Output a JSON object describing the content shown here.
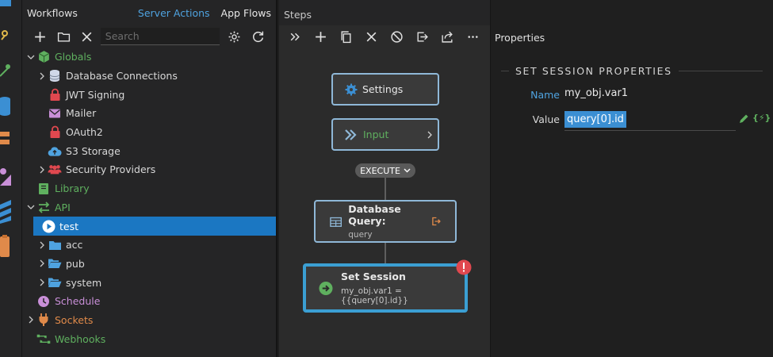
{
  "workflows": {
    "title": "Workflows",
    "tabs": [
      "Server Actions",
      "App Flows"
    ],
    "search_placeholder": "Search",
    "tree": [
      {
        "label": "Globals",
        "color": "#5fb05f",
        "icon": "cube-icon",
        "depth": 0,
        "expanded": true
      },
      {
        "label": "Database Connections",
        "color": "#d8d8d8",
        "icon": "database-icon",
        "depth": 1,
        "expanded": false
      },
      {
        "label": "JWT Signing",
        "color": "#d8d8d8",
        "icon": "lock-icon",
        "depth": 1
      },
      {
        "label": "Mailer",
        "color": "#d8d8d8",
        "icon": "mail-icon",
        "depth": 1
      },
      {
        "label": "OAuth2",
        "color": "#d8d8d8",
        "icon": "lock-icon",
        "depth": 1
      },
      {
        "label": "S3 Storage",
        "color": "#d8d8d8",
        "icon": "cloud-upload-icon",
        "depth": 1
      },
      {
        "label": "Security Providers",
        "color": "#d8d8d8",
        "icon": "users-icon",
        "depth": 1,
        "expanded": false
      },
      {
        "label": "Library",
        "color": "#5fb05f",
        "icon": "book-icon",
        "depth": 0
      },
      {
        "label": "API",
        "color": "#5fb05f",
        "icon": "swap-icon",
        "depth": 0,
        "expanded": true
      },
      {
        "label": "test",
        "color": "#ffffff",
        "icon": "play-icon",
        "depth": 1,
        "selected": true
      },
      {
        "label": "acc",
        "color": "#d8d8d8",
        "icon": "folder-icon",
        "depth": 1,
        "expanded": false
      },
      {
        "label": "pub",
        "color": "#d8d8d8",
        "icon": "folder-open-icon",
        "depth": 1,
        "expanded": false
      },
      {
        "label": "system",
        "color": "#d8d8d8",
        "icon": "folder-open-icon",
        "depth": 1,
        "expanded": false
      },
      {
        "label": "Schedule",
        "color": "#c98fd8",
        "icon": "clock-icon",
        "depth": 0
      },
      {
        "label": "Sockets",
        "color": "#e08a4a",
        "icon": "plug-icon",
        "depth": 0,
        "expanded": false
      },
      {
        "label": "Webhooks",
        "color": "#5fb05f",
        "icon": "webhook-icon",
        "depth": 0
      }
    ]
  },
  "steps": {
    "title": "Steps",
    "nodes": {
      "settings": {
        "label": "Settings"
      },
      "input": {
        "label": "Input"
      },
      "execute": {
        "label": "EXECUTE"
      },
      "db_query": {
        "label": "Database Query:",
        "sub": "query"
      },
      "set_session": {
        "label": "Set Session",
        "sub": "my_obj.var1 = {{query[0].id}}"
      }
    }
  },
  "properties": {
    "title": "Properties",
    "section": "SET SESSION PROPERTIES",
    "name_label": "Name",
    "name_value": "my_obj.var1",
    "value_label": "Value",
    "value_value": "query[0].id",
    "dynamic_label": "{⚡}"
  },
  "colors": {
    "accent_blue": "#4fa3e0",
    "selected_row": "#1b77c2",
    "green": "#5fb05f",
    "error_red": "#e0484f"
  }
}
